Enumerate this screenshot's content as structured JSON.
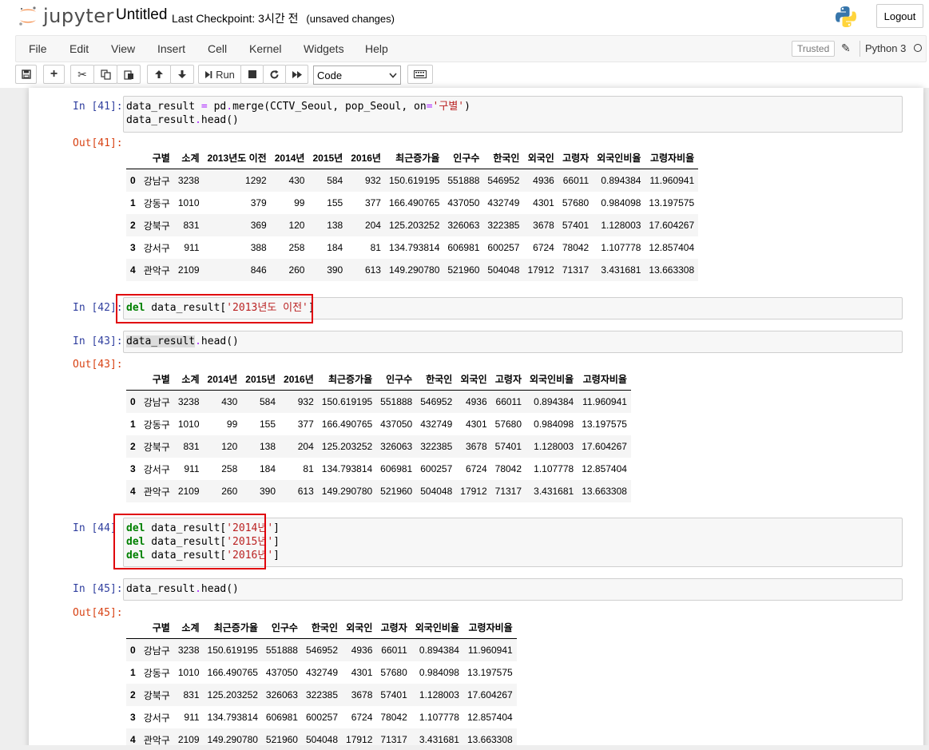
{
  "header": {
    "logo_text": "jupyter",
    "notebook_name": "Untitled",
    "checkpoint_label": "Last Checkpoint: 3시간 전",
    "unsaved": "(unsaved changes)",
    "logout_label": "Logout"
  },
  "menubar": {
    "items": [
      "File",
      "Edit",
      "View",
      "Insert",
      "Cell",
      "Kernel",
      "Widgets",
      "Help"
    ],
    "trusted_label": "Trusted",
    "kernel_name": "Python 3"
  },
  "toolbar": {
    "run_label": "Run",
    "cell_type": "Code"
  },
  "cells": [
    {
      "in_prompt": "In [41]:",
      "code_lines": [
        "data_result = pd.merge(CCTV_Seoul, pop_Seoul, on='구별')",
        "data_result.head()"
      ],
      "out_prompt": "Out[41]:",
      "table": {
        "columns": [
          "구별",
          "소계",
          "2013년도 이전",
          "2014년",
          "2015년",
          "2016년",
          "최근증가율",
          "인구수",
          "한국인",
          "외국인",
          "고령자",
          "외국인비율",
          "고령자비율"
        ],
        "rows": [
          [
            "0",
            "강남구",
            "3238",
            "1292",
            "430",
            "584",
            "932",
            "150.619195",
            "551888",
            "546952",
            "4936",
            "66011",
            "0.894384",
            "11.960941"
          ],
          [
            "1",
            "강동구",
            "1010",
            "379",
            "99",
            "155",
            "377",
            "166.490765",
            "437050",
            "432749",
            "4301",
            "57680",
            "0.984098",
            "13.197575"
          ],
          [
            "2",
            "강북구",
            "831",
            "369",
            "120",
            "138",
            "204",
            "125.203252",
            "326063",
            "322385",
            "3678",
            "57401",
            "1.128003",
            "17.604267"
          ],
          [
            "3",
            "강서구",
            "911",
            "388",
            "258",
            "184",
            "81",
            "134.793814",
            "606981",
            "600257",
            "6724",
            "78042",
            "1.107778",
            "12.857404"
          ],
          [
            "4",
            "관악구",
            "2109",
            "846",
            "260",
            "390",
            "613",
            "149.290780",
            "521960",
            "504048",
            "17912",
            "71317",
            "3.431681",
            "13.663308"
          ]
        ]
      }
    },
    {
      "in_prompt": "In [42]:",
      "code_lines": [
        "del data_result['2013년도 이전']"
      ]
    },
    {
      "in_prompt": "In [43]:",
      "code_lines": [
        "data_result.head()"
      ],
      "out_prompt": "Out[43]:",
      "table": {
        "columns": [
          "구별",
          "소계",
          "2014년",
          "2015년",
          "2016년",
          "최근증가율",
          "인구수",
          "한국인",
          "외국인",
          "고령자",
          "외국인비율",
          "고령자비율"
        ],
        "rows": [
          [
            "0",
            "강남구",
            "3238",
            "430",
            "584",
            "932",
            "150.619195",
            "551888",
            "546952",
            "4936",
            "66011",
            "0.894384",
            "11.960941"
          ],
          [
            "1",
            "강동구",
            "1010",
            "99",
            "155",
            "377",
            "166.490765",
            "437050",
            "432749",
            "4301",
            "57680",
            "0.984098",
            "13.197575"
          ],
          [
            "2",
            "강북구",
            "831",
            "120",
            "138",
            "204",
            "125.203252",
            "326063",
            "322385",
            "3678",
            "57401",
            "1.128003",
            "17.604267"
          ],
          [
            "3",
            "강서구",
            "911",
            "258",
            "184",
            "81",
            "134.793814",
            "606981",
            "600257",
            "6724",
            "78042",
            "1.107778",
            "12.857404"
          ],
          [
            "4",
            "관악구",
            "2109",
            "260",
            "390",
            "613",
            "149.290780",
            "521960",
            "504048",
            "17912",
            "71317",
            "3.431681",
            "13.663308"
          ]
        ]
      }
    },
    {
      "in_prompt": "In [44]",
      "code_lines": [
        "del data_result['2014년']",
        "del data_result['2015년']",
        "del data_result['2016년']"
      ]
    },
    {
      "in_prompt": "In [45]:",
      "code_lines": [
        "data_result.head()"
      ],
      "out_prompt": "Out[45]:",
      "table": {
        "columns": [
          "구별",
          "소계",
          "최근증가율",
          "인구수",
          "한국인",
          "외국인",
          "고령자",
          "외국인비율",
          "고령자비율"
        ],
        "rows": [
          [
            "0",
            "강남구",
            "3238",
            "150.619195",
            "551888",
            "546952",
            "4936",
            "66011",
            "0.894384",
            "11.960941"
          ],
          [
            "1",
            "강동구",
            "1010",
            "166.490765",
            "437050",
            "432749",
            "4301",
            "57680",
            "0.984098",
            "13.197575"
          ],
          [
            "2",
            "강북구",
            "831",
            "125.203252",
            "326063",
            "322385",
            "3678",
            "57401",
            "1.128003",
            "17.604267"
          ],
          [
            "3",
            "강서구",
            "911",
            "134.793814",
            "606981",
            "600257",
            "6724",
            "78042",
            "1.107778",
            "12.857404"
          ],
          [
            "4",
            "관악구",
            "2109",
            "149.290780",
            "521960",
            "504048",
            "17912",
            "71317",
            "3.431681",
            "13.663308"
          ]
        ]
      }
    }
  ],
  "colors": {
    "highlight_box": "#e0000b",
    "in_prompt": "#303f9f",
    "out_prompt": "#d84315",
    "keyword": "#008000",
    "string": "#ba2121"
  }
}
